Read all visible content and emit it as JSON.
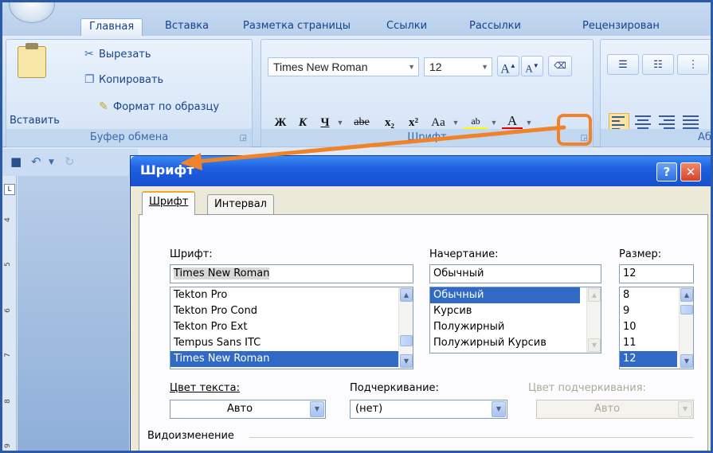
{
  "ribbon": {
    "tabs": [
      "Главная",
      "Вставка",
      "Разметка страницы",
      "Ссылки",
      "Рассылки",
      "Рецензирован"
    ],
    "clipboard": {
      "paste_label": "Вставить",
      "cut_label": "Вырезать",
      "copy_label": "Копировать",
      "format_painter_label": "Формат по образцу",
      "group_title": "Буфер обмена"
    },
    "font": {
      "font_name": "Times New Roman",
      "font_size": "12",
      "grow_label": "A",
      "shrink_label": "A",
      "bold_label": "Ж",
      "italic_label": "К",
      "underline_label": "Ч",
      "strike_label": "abe",
      "subscript_label": "x₂",
      "superscript_label": "x²",
      "case_label": "Aa",
      "highlight_label": "ab",
      "color_label": "A",
      "group_title": "Шрифт",
      "highlight_color": "#f0822a"
    },
    "paragraph_group_title_partial": "Аб"
  },
  "dialog": {
    "title": "Шрифт",
    "help_label": "?",
    "close_label": "✕",
    "tabs": {
      "font": "Шрифт",
      "spacing": "Интервал"
    },
    "font_label": "Шрифт:",
    "font_value": "Times New Roman",
    "font_list": [
      "Tekton Pro",
      "Tekton Pro Cond",
      "Tekton Pro Ext",
      "Tempus Sans ITC",
      "Times New Roman"
    ],
    "style_label": "Начертание:",
    "style_value": "Обычный",
    "style_list": [
      "Обычный",
      "Курсив",
      "Полужирный",
      "Полужирный Курсив"
    ],
    "size_label": "Размер:",
    "size_value": "12",
    "size_list": [
      "8",
      "9",
      "10",
      "11",
      "12"
    ],
    "text_color_label": "Цвет текста:",
    "text_color_value": "Авто",
    "underline_label": "Подчеркивание:",
    "underline_value": "(нет)",
    "underline_color_label": "Цвет подчеркивания:",
    "underline_color_value": "Авто",
    "effects_label": "Видоизменение",
    "title_bar_color": "#1f5fe0",
    "selection_color": "#316ac5"
  }
}
